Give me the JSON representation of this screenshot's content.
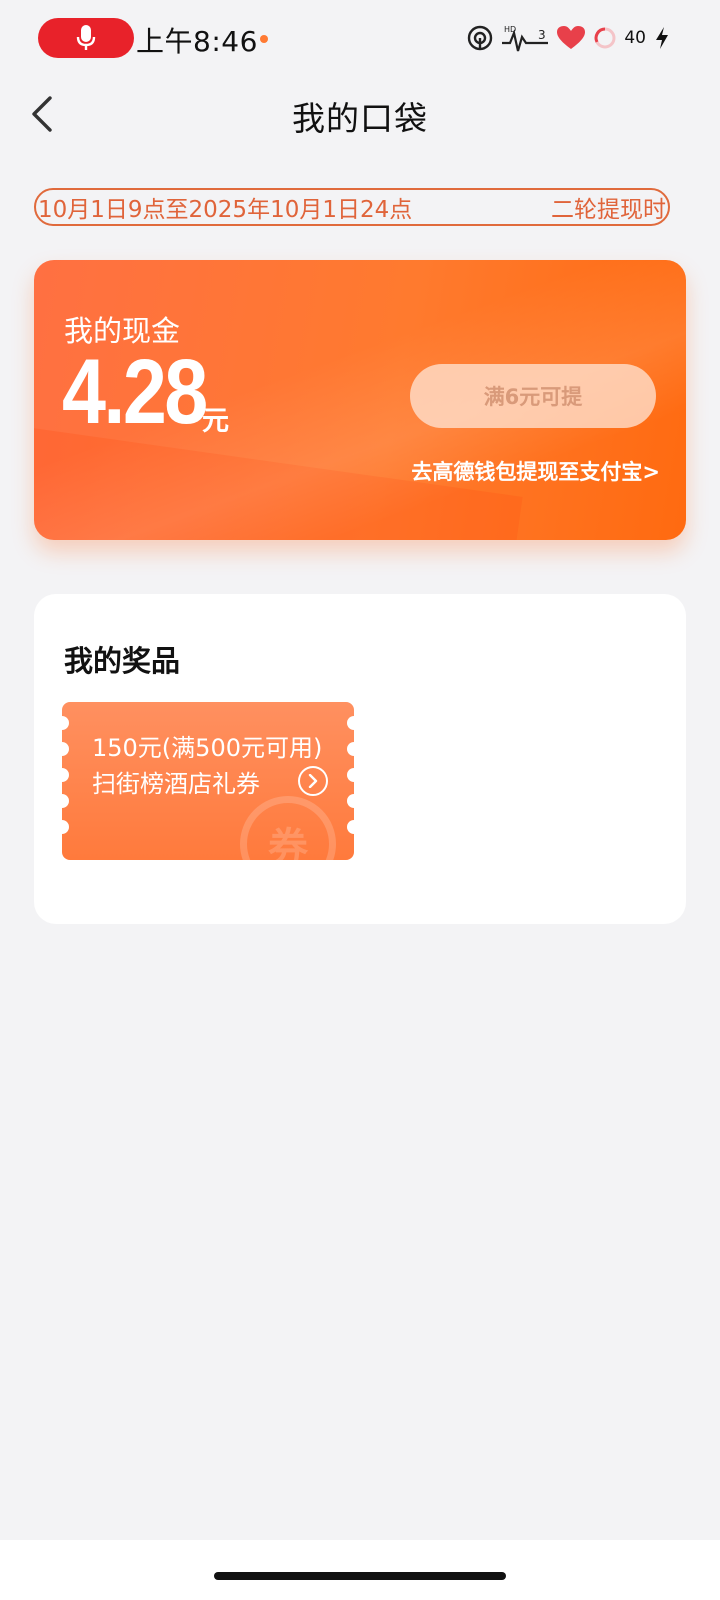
{
  "status_bar": {
    "time": "上午8:46",
    "battery": "40",
    "network": "HD",
    "signal": "3"
  },
  "header": {
    "title": "我的口袋"
  },
  "notice": {
    "left_text": "10月1日9点至2025年10月1日24点",
    "right_text": "二轮提现时"
  },
  "cash": {
    "label": "我的现金",
    "amount": "4.28",
    "unit": "元",
    "withdraw_button": "满6元可提",
    "wallet_link": "去高德钱包提现至支付宝>"
  },
  "prizes": {
    "title": "我的奖品",
    "coupons": [
      {
        "line1": "150元(满500元可用)",
        "line2": "扫街榜酒店礼券",
        "watermark": "券"
      }
    ]
  },
  "colors": {
    "accent": "#ff7a2e",
    "notice": "#e0643a",
    "mic": "#e8222a"
  }
}
